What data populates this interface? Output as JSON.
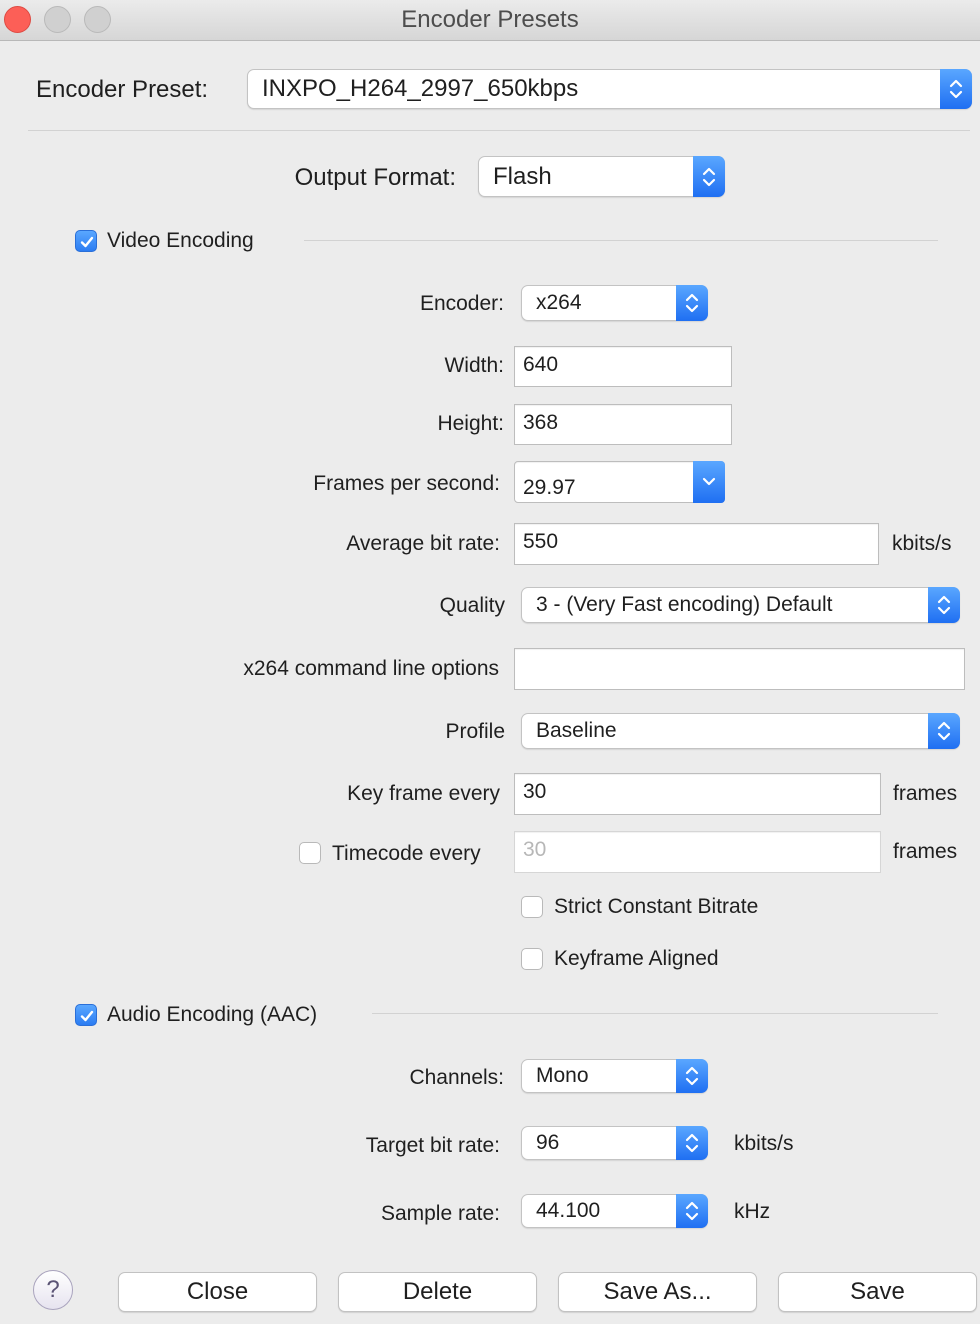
{
  "window": {
    "title": "Encoder Presets"
  },
  "preset": {
    "label": "Encoder Preset:",
    "value": "INXPO_H264_2997_650kbps"
  },
  "output": {
    "label": "Output Format:",
    "value": "Flash"
  },
  "video": {
    "section_label": "Video Encoding",
    "enabled": true,
    "encoder": {
      "label": "Encoder:",
      "value": "x264"
    },
    "width": {
      "label": "Width:",
      "value": "640"
    },
    "height": {
      "label": "Height:",
      "value": "368"
    },
    "fps": {
      "label": "Frames per second:",
      "value": "29.97"
    },
    "bitrate": {
      "label": "Average bit rate:",
      "value": "550",
      "unit": "kbits/s"
    },
    "quality": {
      "label": "Quality",
      "value": "3 - (Very Fast encoding) Default"
    },
    "cmdline": {
      "label": "x264 command line options",
      "value": ""
    },
    "profile": {
      "label": "Profile",
      "value": "Baseline"
    },
    "keyframe": {
      "label": "Key frame every",
      "value": "30",
      "unit": "frames"
    },
    "timecode": {
      "label": "Timecode every",
      "value": "30",
      "unit": "frames",
      "enabled": false
    },
    "strict_cbr": {
      "label": "Strict Constant Bitrate",
      "checked": false
    },
    "keyframe_aligned": {
      "label": "Keyframe Aligned",
      "checked": false
    }
  },
  "audio": {
    "section_label": "Audio Encoding (AAC)",
    "enabled": true,
    "channels": {
      "label": "Channels:",
      "value": "Mono"
    },
    "target_bitrate": {
      "label": "Target bit rate:",
      "value": "96",
      "unit": "kbits/s"
    },
    "sample_rate": {
      "label": "Sample rate:",
      "value": "44.100",
      "unit": "kHz"
    }
  },
  "buttons": {
    "help": "?",
    "close": "Close",
    "delete": "Delete",
    "save_as": "Save As...",
    "save": "Save"
  },
  "colors": {
    "accent": "#2b7cf2",
    "window_bg": "#ececec",
    "close_dot": "#fc5f57"
  },
  "icons": {
    "stepper": "up-down-chevron-icon",
    "dropdown": "chevron-down-icon",
    "check": "checkmark-icon",
    "help": "question-mark-icon"
  }
}
